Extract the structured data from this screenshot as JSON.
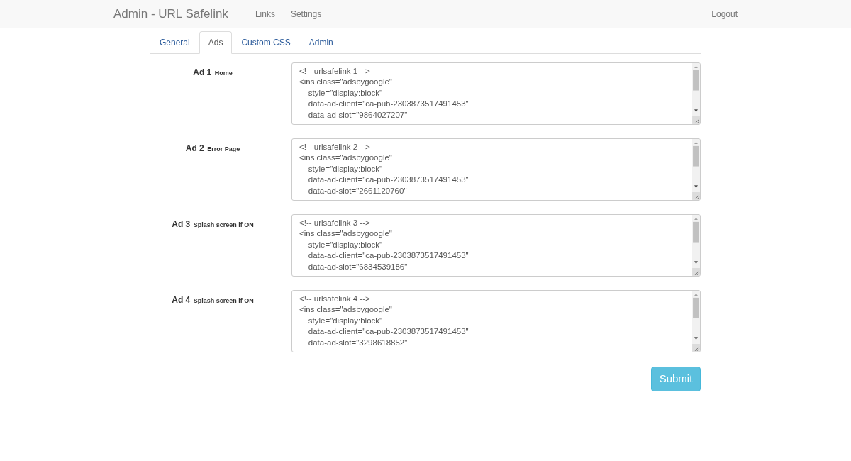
{
  "navbar": {
    "brand": "Admin - URL Safelink",
    "links": [
      {
        "label": "Links"
      },
      {
        "label": "Settings"
      }
    ],
    "logout": "Logout"
  },
  "tabs": [
    {
      "label": "General",
      "selected": false
    },
    {
      "label": "Ads",
      "selected": true
    },
    {
      "label": "Custom CSS",
      "selected": false
    },
    {
      "label": "Admin",
      "selected": false
    }
  ],
  "ads": [
    {
      "label": "Ad 1",
      "note": "Home",
      "code_lines": [
        "<!-- urlsafelink 1 -->",
        "<ins class=\"adsbygoogle\"",
        "    style=\"display:block\"",
        "    data-ad-client=\"ca-pub-2303873517491453\"",
        "    data-ad-slot=\"9864027207\""
      ]
    },
    {
      "label": "Ad 2",
      "note": "Error Page",
      "code_lines": [
        "<!-- urlsafelink 2 -->",
        "<ins class=\"adsbygoogle\"",
        "    style=\"display:block\"",
        "    data-ad-client=\"ca-pub-2303873517491453\"",
        "    data-ad-slot=\"2661120760\""
      ]
    },
    {
      "label": "Ad 3",
      "note": "Splash screen if ON",
      "code_lines": [
        "<!-- urlsafelink 3 -->",
        "<ins class=\"adsbygoogle\"",
        "    style=\"display:block\"",
        "    data-ad-client=\"ca-pub-2303873517491453\"",
        "    data-ad-slot=\"6834539186\""
      ]
    },
    {
      "label": "Ad 4",
      "note": "Splash screen if ON",
      "code_lines": [
        "<!-- urlsafelink 4 -->",
        "<ins class=\"adsbygoogle\"",
        "    style=\"display:block\"",
        "    data-ad-client=\"ca-pub-2303873517491453\"",
        "    data-ad-slot=\"3298618852\""
      ]
    }
  ],
  "submit": "Submit"
}
